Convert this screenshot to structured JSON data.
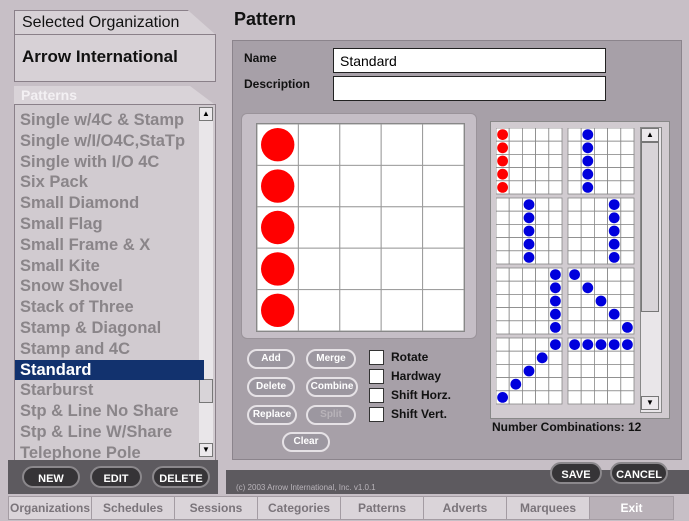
{
  "sidebar": {
    "selected_tab_label": "Selected Organization",
    "org_name": "Arrow International",
    "patterns_tab_label": "Patterns",
    "items": [
      "Single w/4C & Stamp",
      "Single w/I/O4C,StaTp",
      "Single with I/O 4C",
      "Six Pack",
      "Small Diamond",
      "Small Flag",
      "Small Frame & X",
      "Small Kite",
      "Snow Shovel",
      "Stack of Three",
      "Stamp & Diagonal",
      "Stamp and 4C",
      "Standard",
      "Starburst",
      "Stp & Line No Share",
      "Stp & Line W/Share",
      "Telephone Pole"
    ],
    "selected_item": "Standard",
    "buttons": {
      "new": "NEW",
      "edit": "EDIT",
      "delete": "DELETE"
    }
  },
  "header": {
    "title": "Pattern"
  },
  "form": {
    "name_label": "Name",
    "name_value": "Standard",
    "description_label": "Description",
    "description_value": ""
  },
  "pattern_grid": {
    "filled_cells": [
      [
        0,
        0
      ],
      [
        1,
        0
      ],
      [
        2,
        0
      ],
      [
        3,
        0
      ],
      [
        4,
        0
      ]
    ],
    "fill_color": "#ff0000"
  },
  "actions": {
    "add": "Add",
    "merge": "Merge",
    "delete": "Delete",
    "combine": "Combine",
    "replace": "Replace",
    "split": "Split",
    "clear": "Clear"
  },
  "options": {
    "rotate": "Rotate",
    "hardway": "Hardway",
    "shift_horz": "Shift Horz.",
    "shift_vert": "Shift Vert."
  },
  "combinations": {
    "label": "Number Combinations: 12",
    "red": "#ff0000",
    "blue": "#0000dd"
  },
  "save_button": "SAVE",
  "cancel_button": "CANCEL",
  "copyright": "(c) 2003 Arrow International, Inc. v1.0.1",
  "bottom_tabs": [
    "Organizations",
    "Schedules",
    "Sessions",
    "Categories",
    "Patterns",
    "Adverts",
    "Marquees",
    "Exit"
  ],
  "active_tab": "Exit"
}
